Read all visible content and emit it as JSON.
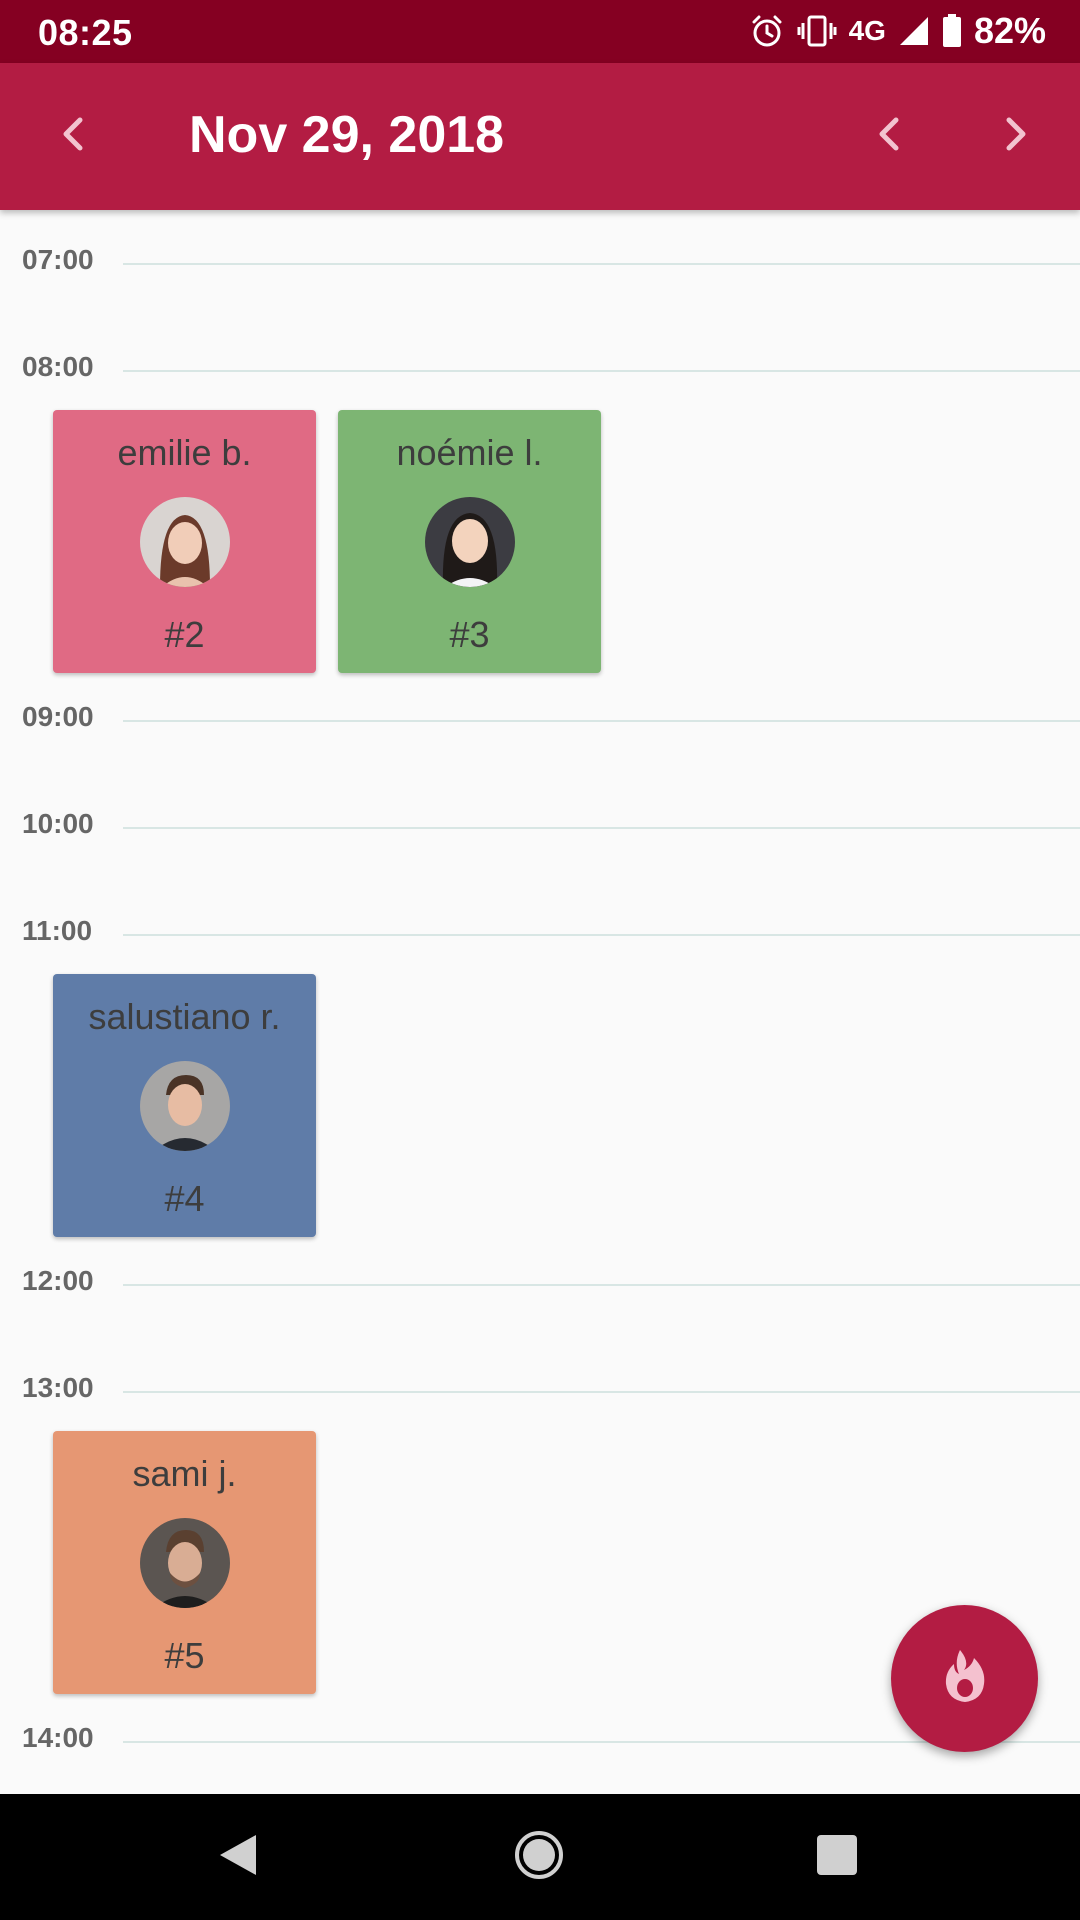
{
  "status_bar": {
    "time": "08:25",
    "network": "4G",
    "battery": "82%",
    "icons": [
      "alarm-icon",
      "vibrate-icon",
      "signal-icon",
      "battery-icon"
    ]
  },
  "header": {
    "date": "Nov 29, 2018",
    "icons": [
      "back-arrow-icon",
      "chevron-left-icon",
      "chevron-right-icon"
    ]
  },
  "timeline": {
    "hours": [
      "07:00",
      "08:00",
      "09:00",
      "10:00",
      "11:00",
      "12:00",
      "13:00",
      "14:00"
    ]
  },
  "appointments": [
    {
      "name": "emilie b.",
      "number": "#2",
      "color": "#e06a84"
    },
    {
      "name": "noémie l.",
      "number": "#3",
      "color": "#7db573"
    },
    {
      "name": "salustiano r.",
      "number": "#4",
      "color": "#5f7ca8"
    },
    {
      "name": "sami j.",
      "number": "#5",
      "color": "#e69773"
    }
  ],
  "fab": {
    "icon": "flame-icon",
    "color": "#b31c43"
  },
  "nav_bar": {
    "icons": [
      "back-triangle-icon",
      "home-circle-icon",
      "recents-square-icon"
    ]
  }
}
